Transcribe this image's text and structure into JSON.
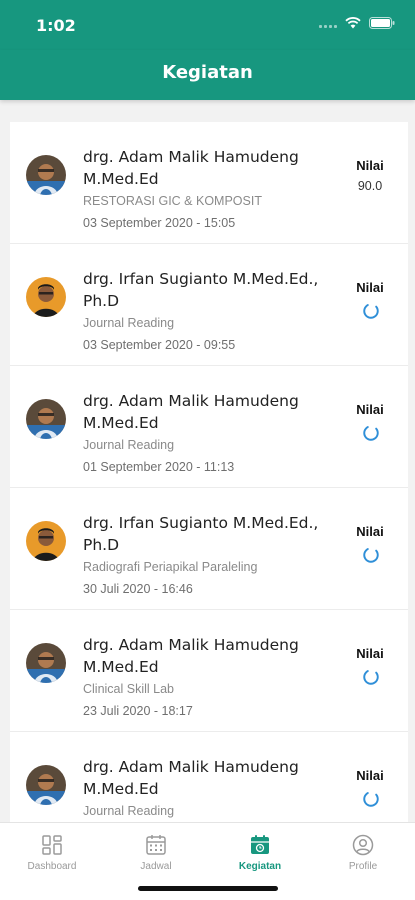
{
  "status_bar": {
    "time": "1:02"
  },
  "header": {
    "title": "Kegiatan"
  },
  "list": {
    "nilai_label": "Nilai",
    "items": [
      {
        "name": "drg. Adam Malik Hamudeng M.Med.Ed",
        "subject": "RESTORASI GIC & KOMPOSIT",
        "datetime": "03 September 2020 - 15:05",
        "score": "90.0",
        "avatar": "avatar-adam"
      },
      {
        "name": "drg. Irfan Sugianto M.Med.Ed., Ph.D",
        "subject": "Journal Reading",
        "datetime": "03 September 2020 - 09:55",
        "score": null,
        "avatar": "avatar-irfan"
      },
      {
        "name": "drg. Adam Malik Hamudeng M.Med.Ed",
        "subject": "Journal Reading",
        "datetime": "01 September 2020 - 11:13",
        "score": null,
        "avatar": "avatar-adam"
      },
      {
        "name": "drg. Irfan Sugianto M.Med.Ed., Ph.D",
        "subject": "Radiografi Periapikal Paraleling",
        "datetime": "30 Juli 2020 - 16:46",
        "score": null,
        "avatar": "avatar-irfan"
      },
      {
        "name": "drg. Adam Malik Hamudeng M.Med.Ed",
        "subject": "Clinical Skill Lab",
        "datetime": "23 Juli 2020 - 18:17",
        "score": null,
        "avatar": "avatar-adam"
      },
      {
        "name": "drg. Adam Malik Hamudeng M.Med.Ed",
        "subject": "Journal Reading",
        "datetime": "",
        "score": null,
        "avatar": "avatar-adam"
      }
    ]
  },
  "bottom_nav": {
    "items": [
      {
        "label": "Dashboard",
        "icon": "dashboard-icon",
        "active": false
      },
      {
        "label": "Jadwal",
        "icon": "calendar-icon",
        "active": false
      },
      {
        "label": "Kegiatan",
        "icon": "activity-icon",
        "active": true
      },
      {
        "label": "Profile",
        "icon": "profile-icon",
        "active": false
      }
    ]
  },
  "colors": {
    "primary": "#17977f",
    "inactive": "#9a9a9a",
    "spinner": "#2f8fd8"
  }
}
